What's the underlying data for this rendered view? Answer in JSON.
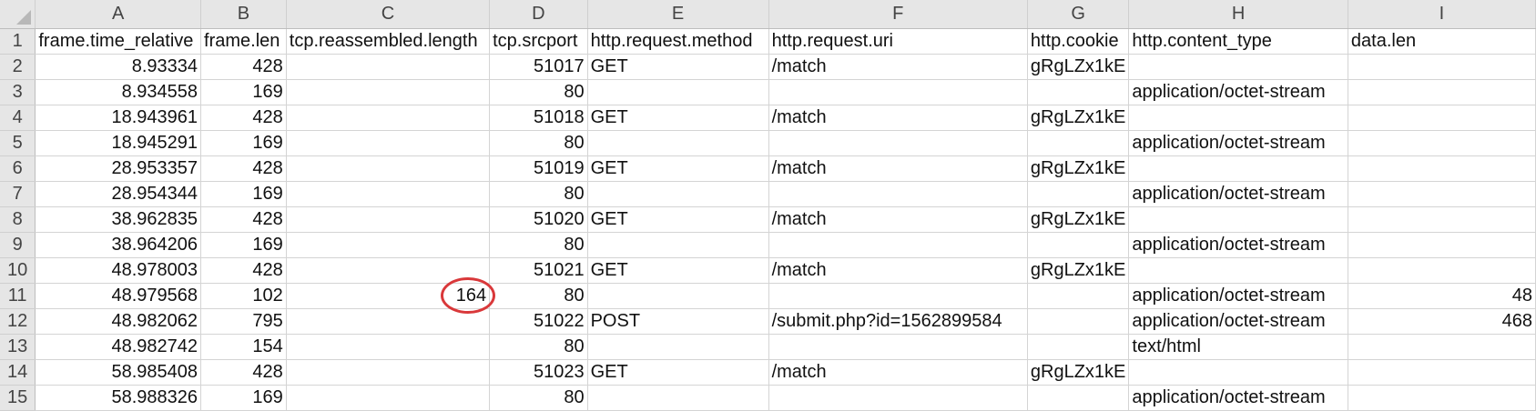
{
  "column_headers": [
    "A",
    "B",
    "C",
    "D",
    "E",
    "F",
    "G",
    "H",
    "I"
  ],
  "field_names": [
    "frame.time_relative",
    "frame.len",
    "tcp.reassembled.length",
    "tcp.srcport",
    "http.request.method",
    "http.request.uri",
    "http.cookie",
    "http.content_type",
    "data.len"
  ],
  "rows": [
    {
      "n": "2",
      "a": "8.93334",
      "b": "428",
      "c": "",
      "d": "51017",
      "e": "GET",
      "f": "/match",
      "g": "gRgLZx1kE",
      "h": "",
      "i": ""
    },
    {
      "n": "3",
      "a": "8.934558",
      "b": "169",
      "c": "",
      "d": "80",
      "e": "",
      "f": "",
      "g": "",
      "h": "application/octet-stream",
      "i": ""
    },
    {
      "n": "4",
      "a": "18.943961",
      "b": "428",
      "c": "",
      "d": "51018",
      "e": "GET",
      "f": "/match",
      "g": "gRgLZx1kE",
      "h": "",
      "i": ""
    },
    {
      "n": "5",
      "a": "18.945291",
      "b": "169",
      "c": "",
      "d": "80",
      "e": "",
      "f": "",
      "g": "",
      "h": "application/octet-stream",
      "i": ""
    },
    {
      "n": "6",
      "a": "28.953357",
      "b": "428",
      "c": "",
      "d": "51019",
      "e": "GET",
      "f": "/match",
      "g": "gRgLZx1kE",
      "h": "",
      "i": ""
    },
    {
      "n": "7",
      "a": "28.954344",
      "b": "169",
      "c": "",
      "d": "80",
      "e": "",
      "f": "",
      "g": "",
      "h": "application/octet-stream",
      "i": ""
    },
    {
      "n": "8",
      "a": "38.962835",
      "b": "428",
      "c": "",
      "d": "51020",
      "e": "GET",
      "f": "/match",
      "g": "gRgLZx1kE",
      "h": "",
      "i": ""
    },
    {
      "n": "9",
      "a": "38.964206",
      "b": "169",
      "c": "",
      "d": "80",
      "e": "",
      "f": "",
      "g": "",
      "h": "application/octet-stream",
      "i": ""
    },
    {
      "n": "10",
      "a": "48.978003",
      "b": "428",
      "c": "",
      "d": "51021",
      "e": "GET",
      "f": "/match",
      "g": "gRgLZx1kE",
      "h": "",
      "i": ""
    },
    {
      "n": "11",
      "a": "48.979568",
      "b": "102",
      "c": "164",
      "d": "80",
      "e": "",
      "f": "",
      "g": "",
      "h": "application/octet-stream",
      "i": "48"
    },
    {
      "n": "12",
      "a": "48.982062",
      "b": "795",
      "c": "",
      "d": "51022",
      "e": "POST",
      "f": "/submit.php?id=1562899584",
      "g": "",
      "h": "application/octet-stream",
      "i": "468"
    },
    {
      "n": "13",
      "a": "48.982742",
      "b": "154",
      "c": "",
      "d": "80",
      "e": "",
      "f": "",
      "g": "",
      "h": "text/html",
      "i": ""
    },
    {
      "n": "14",
      "a": "58.985408",
      "b": "428",
      "c": "",
      "d": "51023",
      "e": "GET",
      "f": "/match",
      "g": "gRgLZx1kE",
      "h": "",
      "i": ""
    },
    {
      "n": "15",
      "a": "58.988326",
      "b": "169",
      "c": "",
      "d": "80",
      "e": "",
      "f": "",
      "g": "",
      "h": "application/octet-stream",
      "i": ""
    }
  ],
  "highlight": {
    "row": "11",
    "column": "C",
    "value": "164",
    "color": "#d9383a"
  },
  "colors": {
    "header_bg": "#e6e6e6",
    "gridline": "#d4d4d4",
    "annotation": "#d9383a"
  }
}
